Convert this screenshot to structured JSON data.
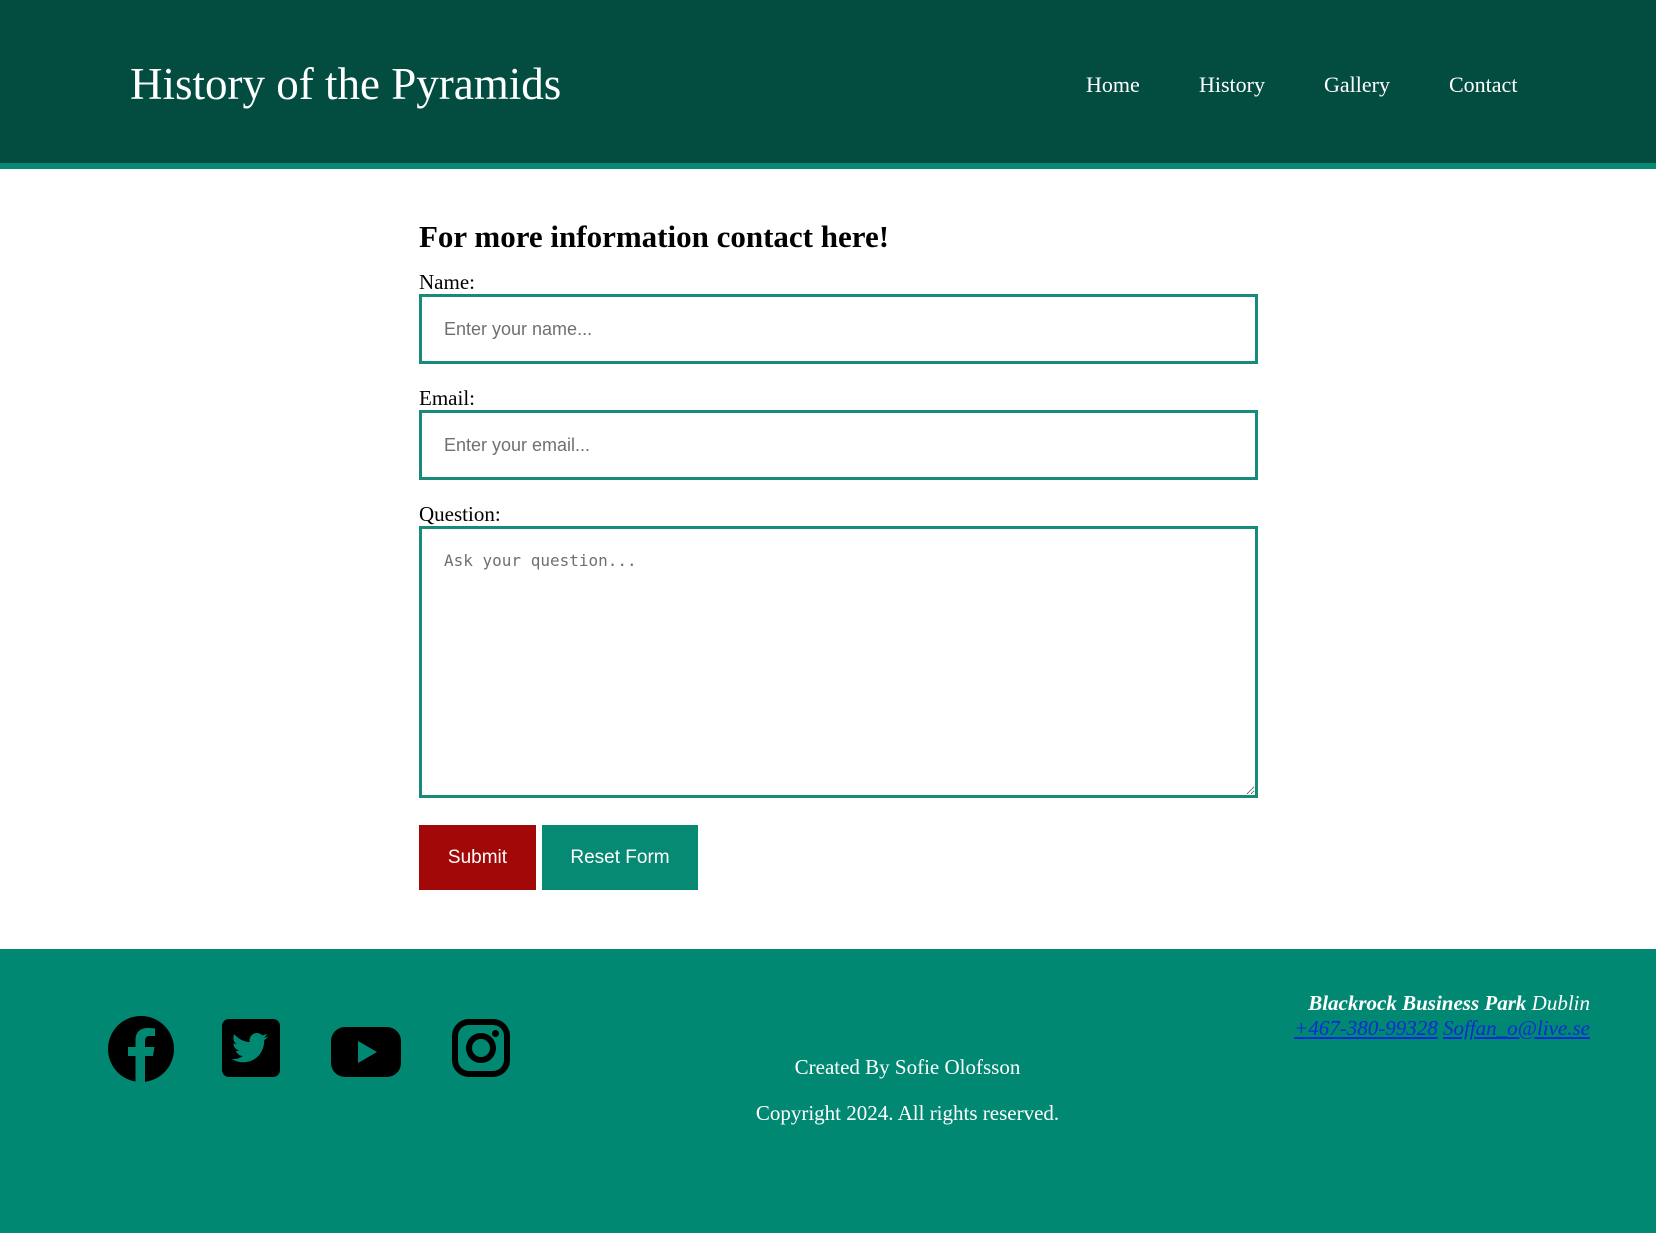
{
  "header": {
    "site_title": "History of the Pyramids",
    "nav": [
      {
        "label": "Home"
      },
      {
        "label": "History"
      },
      {
        "label": "Gallery"
      },
      {
        "label": "Contact"
      }
    ]
  },
  "form": {
    "heading": "For more information contact here!",
    "name_label": "Name:",
    "name_placeholder": "Enter your name...",
    "name_value": "",
    "email_label": "Email:",
    "email_placeholder": "Enter your email...",
    "email_value": "",
    "question_label": "Question:",
    "question_placeholder": "Ask your question...",
    "question_value": "",
    "submit_label": "Submit",
    "reset_label": "Reset Form"
  },
  "footer": {
    "social": [
      {
        "icon": "facebook-icon"
      },
      {
        "icon": "twitter-icon"
      },
      {
        "icon": "youtube-icon"
      },
      {
        "icon": "instagram-icon"
      }
    ],
    "created_by": "Created By Sofie Olofsson",
    "copyright": "Copyright 2024. All rights reserved.",
    "address_place": "Blackrock Business Park",
    "address_city": "Dublin",
    "phone": "+467-380-99328",
    "email": "Soffan_o@live.se"
  },
  "colors": {
    "header_bg": "#034d40",
    "header_border": "#078a74",
    "footer_bg": "#008872",
    "input_border": "#178a7a",
    "submit_bg": "#a30808",
    "reset_bg": "#078a74",
    "link": "#0b2ad8"
  }
}
